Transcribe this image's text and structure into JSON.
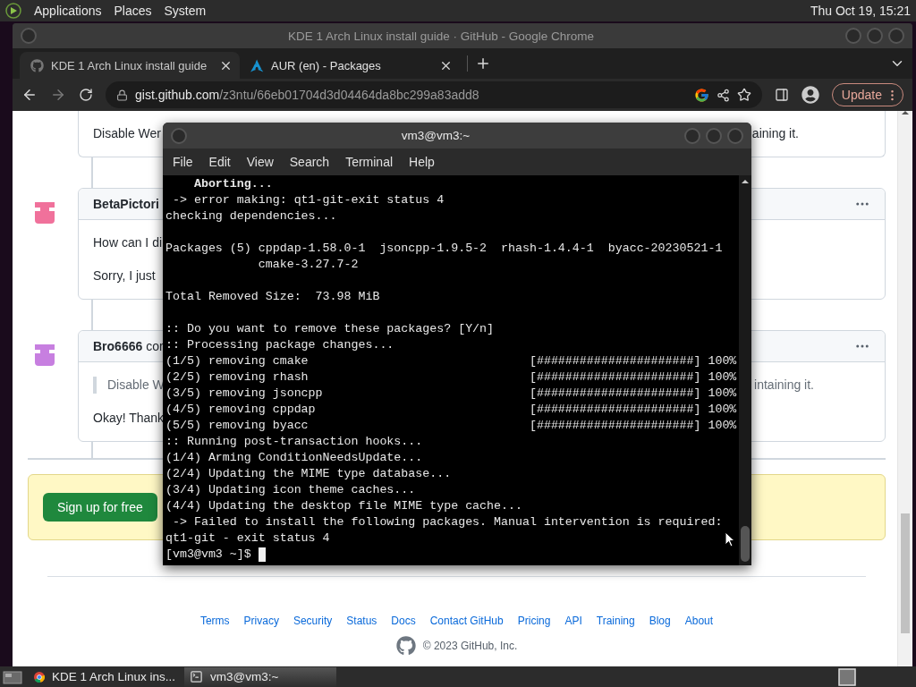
{
  "top_panel": {
    "menus": [
      "Applications",
      "Places",
      "System"
    ],
    "clock": "Thu Oct 19, 15:21"
  },
  "browser": {
    "title": "KDE 1 Arch Linux install guide · GitHub - Google Chrome",
    "tabs": [
      {
        "label": "KDE 1 Arch Linux install guide",
        "selected": true,
        "kind": "github"
      },
      {
        "label": "AUR (en) - Packages",
        "selected": false,
        "kind": "arch"
      }
    ],
    "url": {
      "domain": "gist.github.com",
      "path": "/z3ntu/66eb01704d3d04464da8bc299a83add8"
    },
    "update_button": "Update",
    "comments": [
      {
        "paragraphs": [
          {
            "kind": "text",
            "left": "Disable Wer",
            "right": "aining it."
          }
        ]
      },
      {
        "author": "BetaPictori",
        "color": "#f0719b",
        "paragraphs": [
          {
            "kind": "text",
            "left": "How can I di"
          },
          {
            "kind": "text",
            "left": "Sorry, I just"
          }
        ]
      },
      {
        "author": "Bro6666",
        "author_suffix": "cor",
        "color": "#c77fe0",
        "paragraphs": [
          {
            "kind": "quote",
            "left": "Disable W",
            "right": "intaining it."
          },
          {
            "kind": "text",
            "left": "Okay! Thank"
          }
        ]
      }
    ],
    "signup_button": "Sign up for free",
    "footer_links": [
      "Terms",
      "Privacy",
      "Security",
      "Status",
      "Docs",
      "Contact GitHub",
      "Pricing",
      "API",
      "Training",
      "Blog",
      "About"
    ],
    "copyright": "© 2023 GitHub, Inc."
  },
  "terminal": {
    "title": "vm3@vm3:~",
    "menu": [
      "File",
      "Edit",
      "View",
      "Search",
      "Terminal",
      "Help"
    ],
    "lines": [
      {
        "kind": "bold",
        "text": "    Aborting..."
      },
      {
        "kind": "text",
        "text": " -> error making: qt1-git-exit status 4"
      },
      {
        "kind": "text",
        "text": "checking dependencies..."
      },
      {
        "kind": "blank"
      },
      {
        "kind": "text",
        "text": "Packages (5) cppdap-1.58.0-1  jsoncpp-1.9.5-2  rhash-1.4.4-1  byacc-20230521-1"
      },
      {
        "kind": "text",
        "text": "             cmake-3.27.7-2"
      },
      {
        "kind": "blank"
      },
      {
        "kind": "text",
        "text": "Total Removed Size:  73.98 MiB"
      },
      {
        "kind": "blank"
      },
      {
        "kind": "text",
        "text": ":: Do you want to remove these packages? [Y/n]"
      },
      {
        "kind": "text",
        "text": ":: Processing package changes..."
      },
      {
        "kind": "progress",
        "text": "(1/5) removing cmake",
        "bar": "[######################] 100%"
      },
      {
        "kind": "progress",
        "text": "(2/5) removing rhash",
        "bar": "[######################] 100%"
      },
      {
        "kind": "progress",
        "text": "(3/5) removing jsoncpp",
        "bar": "[######################] 100%"
      },
      {
        "kind": "progress",
        "text": "(4/5) removing cppdap",
        "bar": "[######################] 100%"
      },
      {
        "kind": "progress",
        "text": "(5/5) removing byacc",
        "bar": "[######################] 100%"
      },
      {
        "kind": "text",
        "text": ":: Running post-transaction hooks..."
      },
      {
        "kind": "text",
        "text": "(1/4) Arming ConditionNeedsUpdate..."
      },
      {
        "kind": "text",
        "text": "(2/4) Updating the MIME type database..."
      },
      {
        "kind": "text",
        "text": "(3/4) Updating icon theme caches..."
      },
      {
        "kind": "text",
        "text": "(4/4) Updating the desktop file MIME type cache..."
      },
      {
        "kind": "text",
        "text": " -> Failed to install the following packages. Manual intervention is required:"
      },
      {
        "kind": "text",
        "text": "qt1-git - exit status 4"
      },
      {
        "kind": "prompt",
        "text": "[vm3@vm3 ~]$ "
      }
    ]
  },
  "taskbar": {
    "tasks": [
      {
        "label": "KDE 1 Arch Linux ins...",
        "selected": false,
        "kind": "browser"
      },
      {
        "label": "vm3@vm3:~",
        "selected": true,
        "kind": "terminal"
      }
    ]
  }
}
